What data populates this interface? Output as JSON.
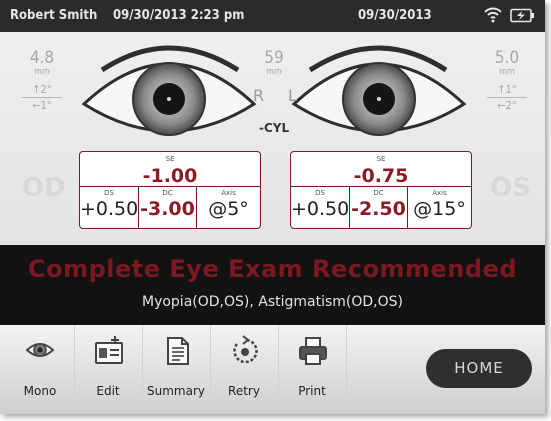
{
  "status_bar": {
    "user_name": "Robert Smith",
    "datetime": "09/30/2013 2:23 pm",
    "date_right": "09/30/2013"
  },
  "od": {
    "label": "OD",
    "pd_value": "4.8",
    "pd_unit": "mm",
    "vertical": "↑2°",
    "horizontal": "←1°",
    "se_label": "SE",
    "se_value": "-1.00",
    "ds_label": "DS",
    "ds_value": "+0.50",
    "dc_label": "DC",
    "dc_value": "-3.00",
    "axis_label": "Axis",
    "axis_value": "@5°"
  },
  "os": {
    "label": "OS",
    "pd_value": "5.0",
    "pd_unit": "mm",
    "vertical": "↑1°",
    "horizontal": "←2°",
    "se_label": "SE",
    "se_value": "-0.75",
    "ds_label": "DS",
    "ds_value": "+0.50",
    "dc_label": "DC",
    "dc_value": "-2.50",
    "axis_label": "Axis",
    "axis_value": "@15°"
  },
  "center": {
    "value": "59",
    "unit": "mm",
    "r_label": "R",
    "l_label": "L",
    "cyl_label": "-CYL"
  },
  "banner": {
    "headline": "Complete Eye Exam Recommended",
    "subtext": "Myopia(OD,OS), Astigmatism(OD,OS)"
  },
  "toolbar": {
    "items": [
      "Mono",
      "Edit",
      "Summary",
      "Retry",
      "Print"
    ],
    "home_label": "HOME"
  },
  "colors": {
    "accent": "#8a1c26",
    "banner_bg": "#121212",
    "status_bg": "#2b2b2b"
  }
}
